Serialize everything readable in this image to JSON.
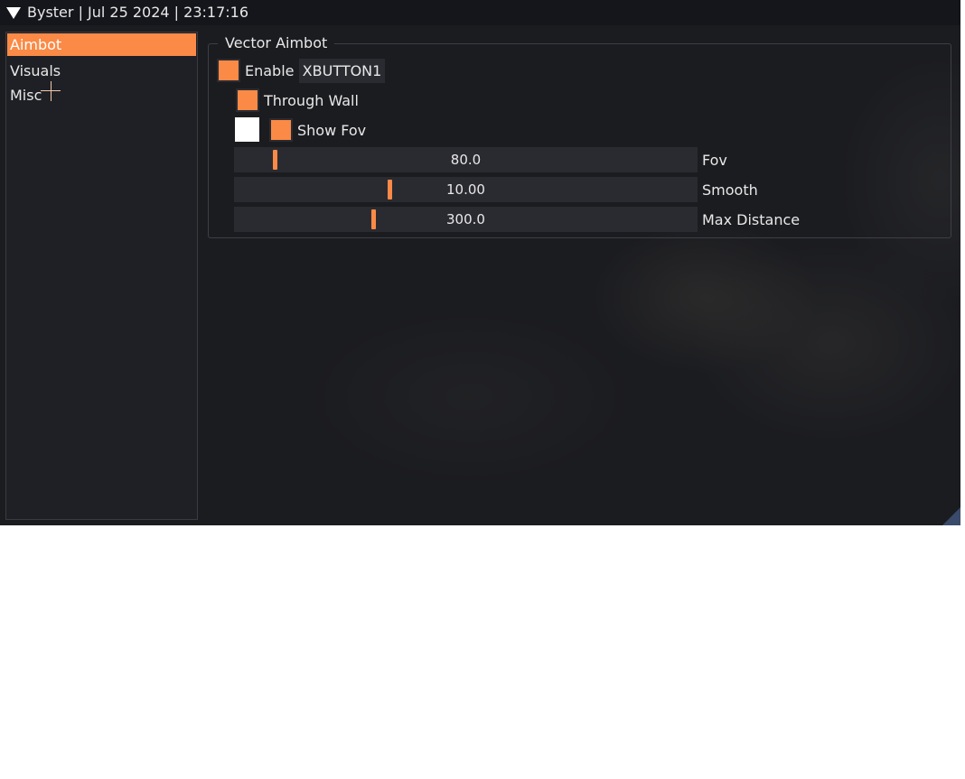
{
  "window": {
    "title": "Byster | Jul 25 2024 | 23:17:16"
  },
  "colors": {
    "accent": "#fb8a46",
    "background": "#1b1c20",
    "frame": "#2a2b31",
    "text": "#e8e8e8"
  },
  "sidebar": {
    "items": [
      {
        "label": "Aimbot",
        "active": true
      },
      {
        "label": "Visuals",
        "active": false
      },
      {
        "label": "Misc",
        "active": false
      }
    ]
  },
  "aimbot": {
    "group_title": "Vector Aimbot",
    "enable": {
      "label": "Enable",
      "checked": true,
      "keybind": "XBUTTON1"
    },
    "through_wall": {
      "label": "Through Wall",
      "checked": true
    },
    "show_fov": {
      "label": "Show Fov",
      "checked": true,
      "color": "#ffffff"
    },
    "sliders": [
      {
        "label": "Fov",
        "value": "80.0",
        "fraction": 0.085
      },
      {
        "label": "Smooth",
        "value": "10.00",
        "fraction": 0.335
      },
      {
        "label": "Max Distance",
        "value": "300.0",
        "fraction": 0.3
      }
    ]
  }
}
